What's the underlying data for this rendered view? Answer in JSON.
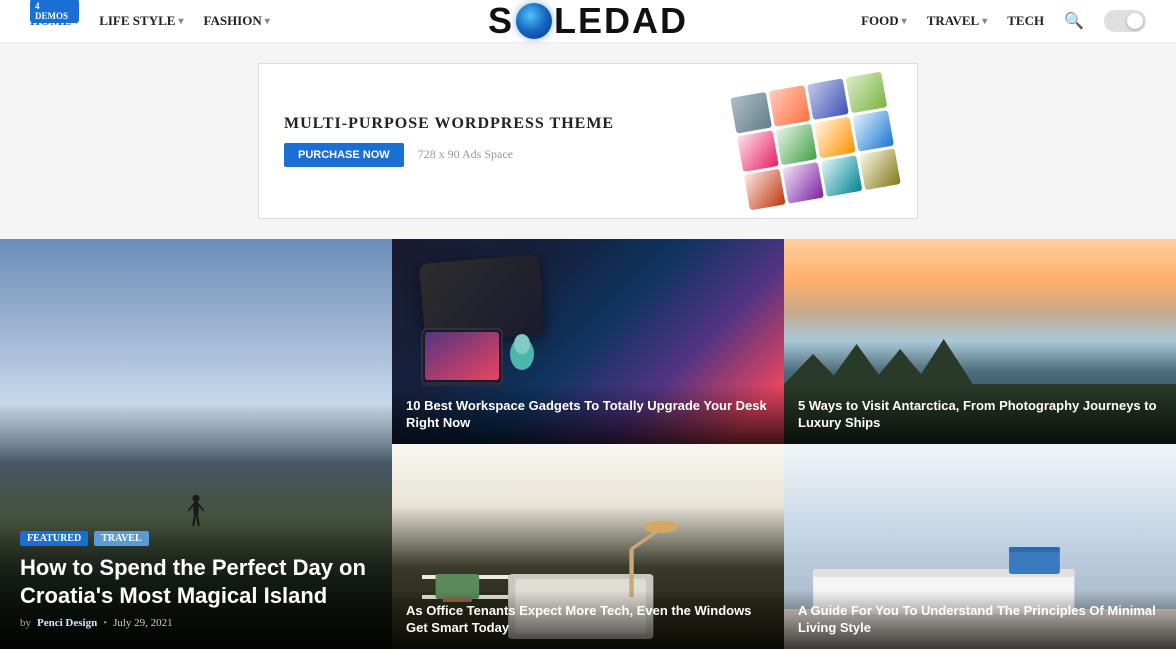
{
  "header": {
    "demos_badge": "4 DEMOS",
    "nav_left": [
      {
        "id": "home",
        "label": "HOME",
        "has_chevron": true,
        "active": true
      },
      {
        "id": "lifestyle",
        "label": "LIFE STYLE",
        "has_chevron": true
      },
      {
        "id": "fashion",
        "label": "FASHION",
        "has_chevron": true
      }
    ],
    "logo_text_before": "S",
    "logo_text_after": "LEDAD",
    "nav_right": [
      {
        "id": "food",
        "label": "FOOD",
        "has_chevron": true
      },
      {
        "id": "travel",
        "label": "TRAVEL",
        "has_chevron": true
      },
      {
        "id": "tech",
        "label": "TECH",
        "has_chevron": false
      }
    ],
    "search_label": "Search",
    "theme_toggle_label": "Toggle theme"
  },
  "ad": {
    "headline": "MULTI-PURPOSE WORDPRESS THEME",
    "button_label": "PURCHASE NOW",
    "space_label": "728 x 90 Ads Space"
  },
  "articles": [
    {
      "id": "croatia",
      "tag1": "Featured",
      "tag2": "Travel",
      "title": "How to Spend the Perfect Day on Croatia's Most Magical Island",
      "author": "Penci Design",
      "date": "July 29, 2021",
      "size": "large"
    },
    {
      "id": "gadgets",
      "title": "10 Best Workspace Gadgets To Totally Upgrade Your Desk Right Now",
      "size": "small"
    },
    {
      "id": "antarctica",
      "title": "5 Ways to Visit Antarctica, From Photography Journeys to Luxury Ships",
      "size": "small"
    },
    {
      "id": "office",
      "title": "As Office Tenants Expect More Tech, Even the Windows Get Smart Today",
      "size": "small"
    },
    {
      "id": "living",
      "title": "A Guide For You To Understand The Principles Of Minimal Living Style",
      "size": "small"
    }
  ]
}
